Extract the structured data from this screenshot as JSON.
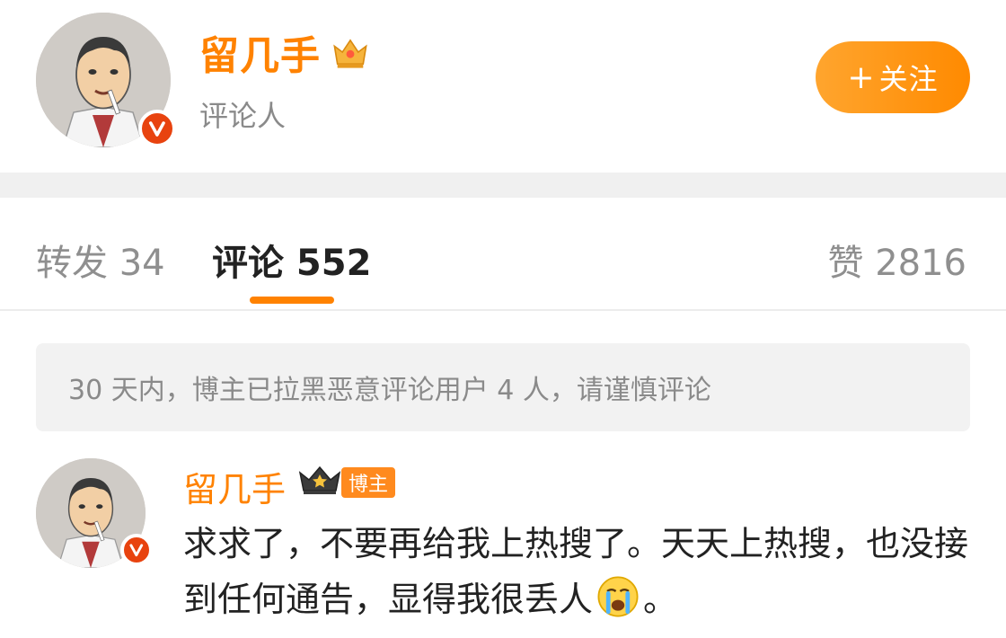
{
  "profile": {
    "name": "留几手",
    "role": "评论人",
    "follow_label": "关注",
    "follow_prefix": "+"
  },
  "tabs": {
    "repost": "转发 34",
    "comment": "评论 552",
    "like": "赞 2816"
  },
  "notice": "30 天内，博主已拉黑恶意评论用户 4 人，请谨慎评论",
  "comment": {
    "author": "留几手",
    "badge": "博主",
    "text_before_emoji": "求求了，不要再给我上热搜了。天天上热搜，也没接到任何通告，显得我很丢人",
    "text_after_emoji": "。",
    "emoji": "crying-face-icon"
  },
  "colors": {
    "accent": "#ff8200",
    "verified": "#e8430f",
    "muted": "#8a8a8a"
  }
}
